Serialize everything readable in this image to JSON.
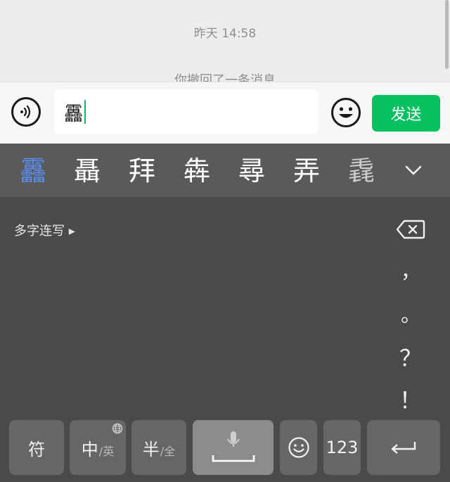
{
  "chat": {
    "timestamp": "昨天 14:58",
    "recall_notice": "你撤回了一条消息"
  },
  "input_bar": {
    "text_value": "靐",
    "send_label": "发送"
  },
  "candidates": [
    "靐",
    "聶",
    "拜",
    "犇",
    "尋",
    "弄",
    "毳"
  ],
  "keyboard": {
    "multi_char_label": "多字连写 ▸",
    "punctuation": [
      "，",
      "。",
      "？",
      "！"
    ],
    "keys": {
      "symbols": "符",
      "lang_main": "中",
      "lang_sub": "/英",
      "width_main": "半",
      "width_sub": "/全",
      "numbers": "123"
    }
  },
  "colors": {
    "accent": "#07c160",
    "candidate_active": "#5b8def",
    "keyboard_bg": "#4a4a4a"
  }
}
